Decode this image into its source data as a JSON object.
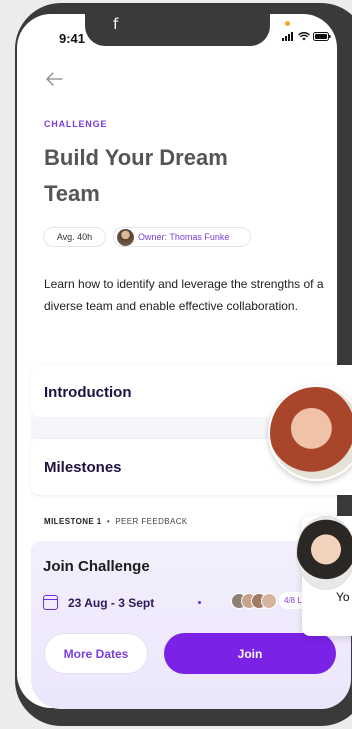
{
  "status": {
    "time": "9:41",
    "notch_mark": "f"
  },
  "challenge": {
    "eyebrow": "CHALLENGE",
    "title": "Build Your Dream Team",
    "avg_time": "Avg. 40h",
    "owner": "Owner: Thomas Funke",
    "description": "Learn how to identify and leverage the strengths of a diverse team and enable effective collaboration."
  },
  "sections": {
    "introduction": "Introduction",
    "milestones": "Milestones"
  },
  "milestone": {
    "number": "MILESTONE 1",
    "separator": "•",
    "type": "PEER FEEDBACK"
  },
  "join": {
    "title": "Join Challenge",
    "dates": "23 Aug - 3 Sept",
    "separator": "•",
    "leaders_badge": "4/8 Le",
    "more_dates": "More Dates",
    "join_label": "Join"
  },
  "video_card": {
    "text": "Yo"
  },
  "colors": {
    "accent": "#7a22e6",
    "accent_text": "#7b3fd9",
    "heading": "#1f1140",
    "sheet_bg": "#f3effc"
  },
  "icons": {
    "back": "arrow-left-icon",
    "calendar": "calendar-icon",
    "signal": "signal-icon",
    "wifi": "wifi-icon",
    "battery": "battery-icon"
  }
}
